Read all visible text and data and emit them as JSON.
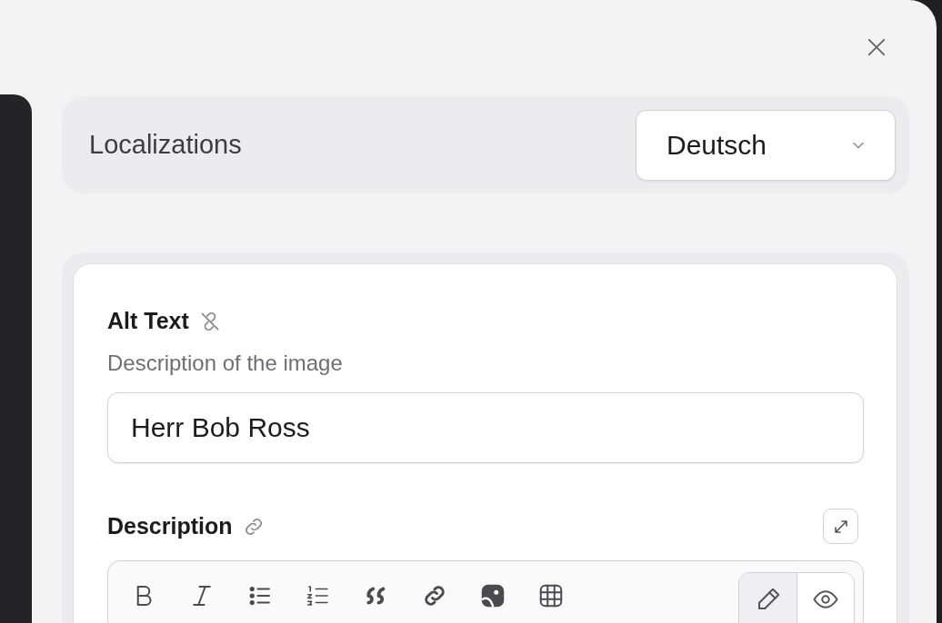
{
  "localizations": {
    "label": "Localizations",
    "language": "Deutsch"
  },
  "fields": [
    {
      "label": "Alt Text",
      "linked": false,
      "hint": "Description of the image",
      "value": "Herr Bob Ross"
    },
    {
      "label": "Description",
      "linked": true
    }
  ],
  "editor": {
    "toolbar": [
      {
        "kind": "bold"
      },
      {
        "kind": "italic"
      },
      {
        "kind": "bullets"
      },
      {
        "kind": "numbers"
      },
      {
        "kind": "quote"
      },
      {
        "kind": "link"
      },
      {
        "kind": "image"
      },
      {
        "kind": "table"
      }
    ],
    "modes": [
      {
        "kind": "edit",
        "selected": true
      },
      {
        "kind": "preview",
        "selected": false
      }
    ]
  }
}
